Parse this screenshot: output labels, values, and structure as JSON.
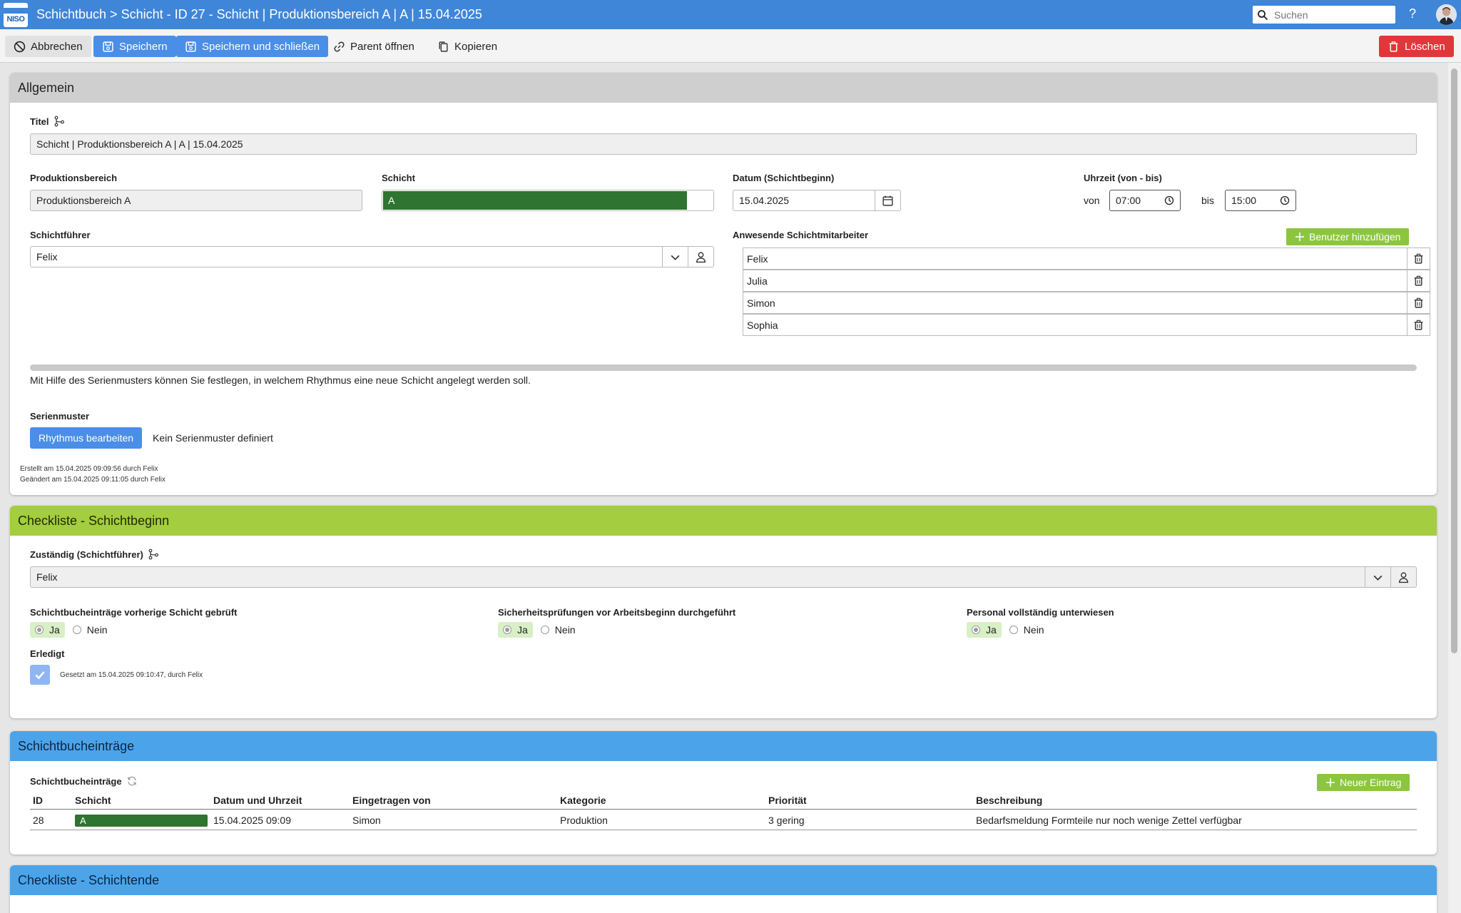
{
  "header": {
    "logo_text": "NISO",
    "title": "Schichtbuch > Schicht - ID 27 - Schicht | Produktionsbereich A | A | 15.04.2025",
    "search_placeholder": "Suchen",
    "help": "?"
  },
  "toolbar": {
    "cancel": "Abbrechen",
    "save": "Speichern",
    "save_close": "Speichern und schließen",
    "open_parent": "Parent öffnen",
    "copy": "Kopieren",
    "delete": "Löschen"
  },
  "allgemein": {
    "heading": "Allgemein",
    "titel_label": "Titel",
    "titel_value": "Schicht | Produktionsbereich A | A | 15.04.2025",
    "produktionsbereich_label": "Produktionsbereich",
    "produktionsbereich_value": "Produktionsbereich A",
    "schicht_label": "Schicht",
    "schicht_value": "A",
    "schicht_color": "#2f7430",
    "datum_label": "Datum (Schichtbeginn)",
    "datum_value": "15.04.2025",
    "uhrzeit_label": "Uhrzeit (von - bis)",
    "von_label": "von",
    "von_value": "07:00",
    "bis_label": "bis",
    "bis_value": "15:00",
    "schichtfuehrer_label": "Schichtführer",
    "schichtfuehrer_value": "Felix",
    "mitarbeiter_label": "Anwesende Schichtmitarbeiter",
    "add_user_button": "Benutzer hinzufügen",
    "mitarbeiter": [
      "Felix",
      "Julia",
      "Simon",
      "Sophia"
    ],
    "serien_hint": "Mit Hilfe des Serienmusters können Sie festlegen, in welchem Rhythmus eine neue Schicht angelegt werden soll.",
    "serienmuster_label": "Serienmuster",
    "rhythmus_button": "Rhythmus bearbeiten",
    "serienmuster_status": "Kein Serienmuster definiert",
    "created": "Erstellt am 15.04.2025 09:09:56 durch Felix",
    "changed": "Geändert am 15.04.2025 09:11:05 durch Felix"
  },
  "checkliste_beginn": {
    "heading": "Checkliste - Schichtbeginn",
    "zustaendig_label": "Zuständig (Schichtführer)",
    "zustaendig_value": "Felix",
    "questions": [
      {
        "label": "Schichtbucheinträge vorherige Schicht gebrüft",
        "yes": "Ja",
        "no": "Nein"
      },
      {
        "label": "Sicherheitsprüfungen vor Arbeitsbeginn durchgeführt",
        "yes": "Ja",
        "no": "Nein"
      },
      {
        "label": "Personal vollständig unterwiesen",
        "yes": "Ja",
        "no": "Nein"
      }
    ],
    "erledigt_label": "Erledigt",
    "erledigt_note": "Gesetzt am 15.04.2025 09:10:47, durch Felix"
  },
  "eintraege": {
    "heading": "Schichtbucheinträge",
    "sub_label": "Schichtbucheinträge",
    "new_button": "Neuer Eintrag",
    "columns": [
      "ID",
      "Schicht",
      "Datum und Uhrzeit",
      "Eingetragen von",
      "Kategorie",
      "Priorität",
      "Beschreibung"
    ],
    "rows": [
      {
        "id": "28",
        "schicht": "A",
        "datum": "15.04.2025 09:09",
        "von": "Simon",
        "kategorie": "Produktion",
        "prioritaet": "3 gering",
        "beschreibung": "Bedarfsmeldung Formteile nur noch wenige Zettel verfügbar"
      }
    ]
  },
  "checkliste_ende": {
    "heading": "Checkliste - Schichtende"
  }
}
